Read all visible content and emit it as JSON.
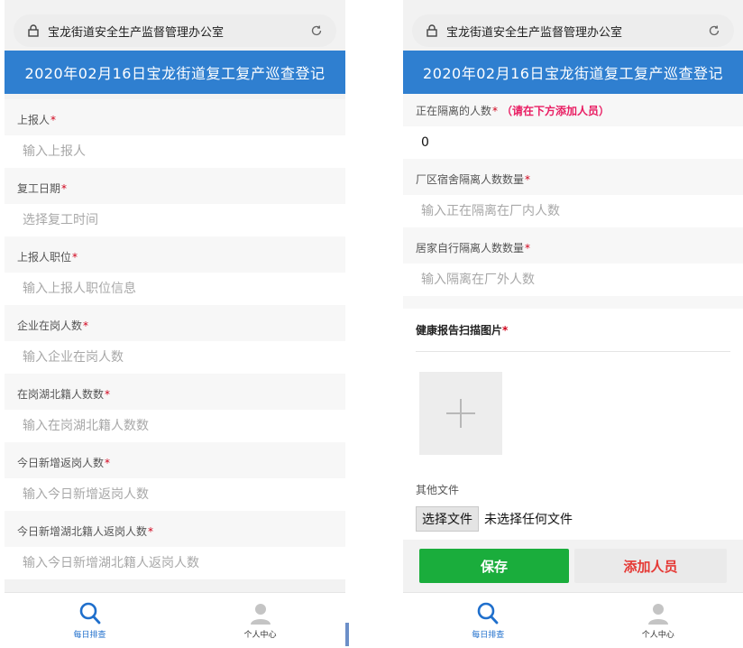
{
  "left": {
    "address": "宝龙街道安全生产监督管理办公室",
    "title": "2020年02月16日宝龙街道复工复产巡查登记",
    "fields": [
      {
        "label": "上报人",
        "placeholder": "输入上报人"
      },
      {
        "label": "复工日期",
        "placeholder": "选择复工时间"
      },
      {
        "label": "上报人职位",
        "placeholder": "输入上报人职位信息"
      },
      {
        "label": "企业在岗人数",
        "placeholder": "输入企业在岗人数"
      },
      {
        "label": "在岗湖北籍人数数",
        "placeholder": "输入在岗湖北籍人数数"
      },
      {
        "label": "今日新增返岗人数",
        "placeholder": "输入今日新增返岗人数"
      },
      {
        "label": "今日新增湖北籍人返岗人数",
        "placeholder": "输入今日新增湖北籍人返岗人数"
      }
    ],
    "required_mark": "*",
    "tabs": {
      "daily": "每日排查",
      "profile": "个人中心"
    }
  },
  "right": {
    "address": "宝龙街道安全生产监督管理办公室",
    "title": "2020年02月16日宝龙街道复工复产巡查登记",
    "isolating": {
      "label": "正在隔离的人数",
      "note": "（请在下方添加人员）",
      "value": "0"
    },
    "fields": [
      {
        "label": "厂区宿舍隔离人数数量",
        "placeholder": "输入正在隔离在厂内人数"
      },
      {
        "label": "居家自行隔离人数数量",
        "placeholder": "输入隔离在厂外人数"
      }
    ],
    "health_title": "健康报告扫描图片",
    "other_files": "其他文件",
    "choose_file": "选择文件",
    "no_file": "未选择任何文件",
    "save": "保存",
    "add_person": "添加人员",
    "required_mark": "*",
    "tabs": {
      "daily": "每日排查",
      "profile": "个人中心"
    }
  },
  "colors": {
    "header_blue": "#2f7fd0",
    "save_green": "#1aad3c",
    "required_red": "#d0021b",
    "note_pink": "#e91e63",
    "tab_active": "#1f6fcc"
  }
}
